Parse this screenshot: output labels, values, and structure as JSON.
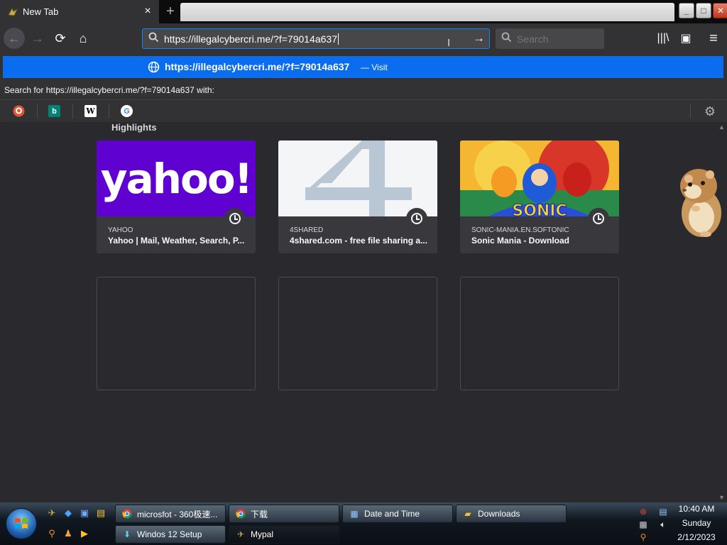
{
  "tab": {
    "title": "New Tab",
    "close_glyph": "×"
  },
  "newtab_glyph": "+",
  "window_controls": {
    "minimize": "_",
    "maximize": "□",
    "close": "✕"
  },
  "nav": {
    "back_glyph": "←",
    "forward_glyph": "→",
    "reload_glyph": "⟳",
    "home_glyph": "⌂"
  },
  "urlbar": {
    "value": "https://illegalcybercri.me/?f=79014a637",
    "go_glyph": "→"
  },
  "searchbar": {
    "placeholder": "Search"
  },
  "toolbar": {
    "library_glyph": "|||\\",
    "sidebar_glyph": "▣",
    "menu_glyph": "≡"
  },
  "autocomplete": {
    "url": "https://illegalcybercri.me/?f=79014a637",
    "separator": "—",
    "action": "Visit"
  },
  "search_with": "Search for https://illegalcybercri.me/?f=79014a637 with:",
  "engines": [
    {
      "name": "duckduckgo-icon",
      "glyph": "D",
      "bg": "#de5833",
      "fg": "#ffffff"
    },
    {
      "name": "bing-icon",
      "glyph": "b",
      "bg": "#008373",
      "fg": "#ffffff"
    },
    {
      "name": "wikipedia-icon",
      "glyph": "W",
      "bg": "#ffffff",
      "fg": "#000000"
    },
    {
      "name": "google-icon",
      "glyph": "G",
      "bg": "#ffffff",
      "fg": "#4285f4"
    }
  ],
  "highlights": {
    "title": "Highlights",
    "cards": [
      {
        "host": "YAHOO",
        "title": "Yahoo | Mail, Weather, Search, P...",
        "thumb_text": "yahoo!"
      },
      {
        "host": "4SHARED",
        "title": "4shared.com - free file sharing a...",
        "thumb_text": "4"
      },
      {
        "host": "SONIC-MANIA.EN.SOFTONIC",
        "title": "Sonic Mania - Download",
        "thumb_text": "SONIC"
      }
    ]
  },
  "taskbar": {
    "buttons": [
      {
        "label": "microsfot - 360极速...",
        "icon": "chrome-icon"
      },
      {
        "label": "下载",
        "icon": "chrome-icon"
      },
      {
        "label": "Date and Time",
        "icon": "control-panel-icon"
      },
      {
        "label": "Downloads",
        "icon": "folder-icon"
      },
      {
        "label": "Windos 12 Setup",
        "icon": "setup-icon"
      },
      {
        "label": "Mypal",
        "icon": "mypal-icon"
      }
    ],
    "clock": {
      "time": "10:40 AM",
      "day": "Sunday",
      "date": "2/12/2023"
    }
  },
  "colors": {
    "accent": "#0a84ff",
    "autocomplete_bg": "#0a6df0",
    "content_bg": "#2a2a2e",
    "card_bg": "#38383d",
    "yahoo_purple": "#5f01d1"
  }
}
